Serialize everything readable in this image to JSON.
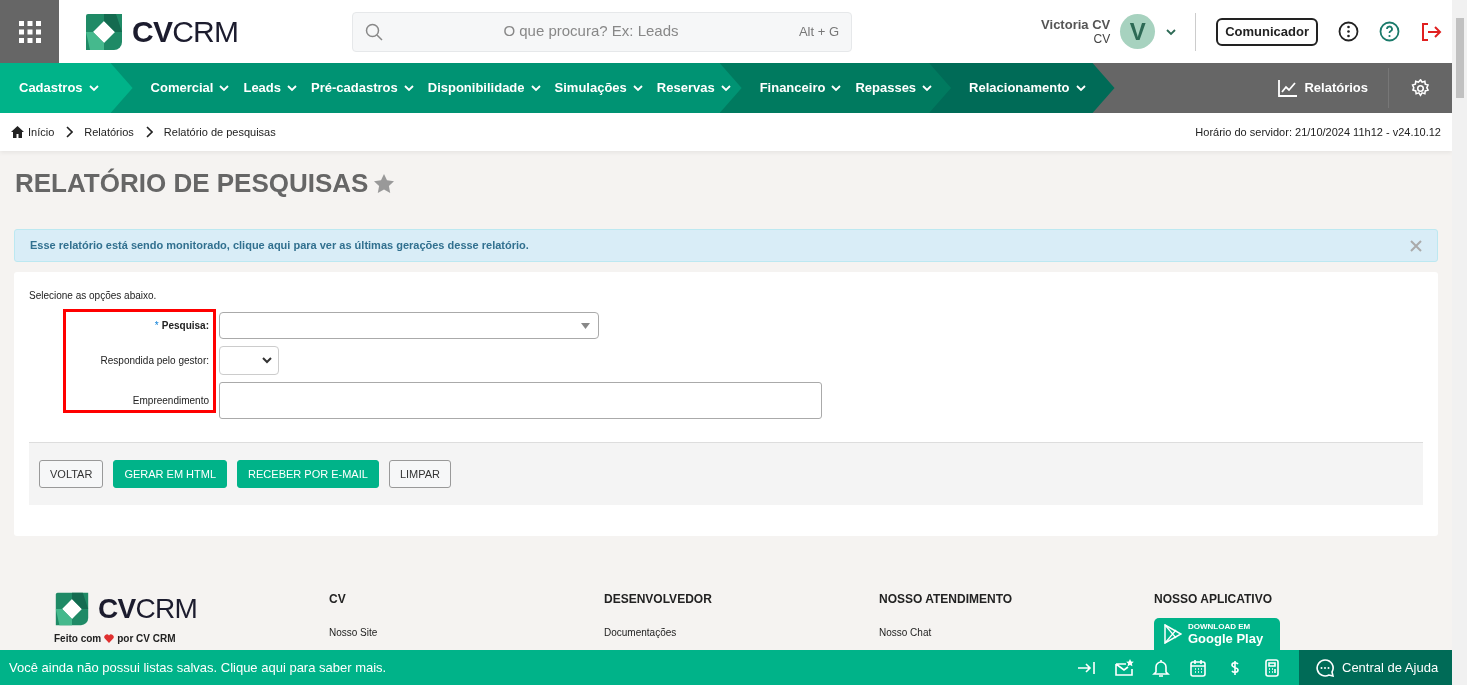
{
  "header": {
    "logo": "**CV**CRM",
    "search": {
      "placeholder": "O que procura? Ex: Leads",
      "shortcut": "Alt + G"
    },
    "user": {
      "name": "Victoria CV",
      "subtitle": "CV",
      "initial": "V"
    },
    "communicator_button": "Comunicador"
  },
  "nav": {
    "groups": [
      {
        "color": "#00b389",
        "items": [
          "Cadastros"
        ]
      },
      {
        "color": "#009373",
        "items": [
          "Comercial",
          "Leads",
          "Pré-cadastros",
          "Disponibilidade",
          "Simulações",
          "Reservas"
        ]
      },
      {
        "color": "#007a5f",
        "items": [
          "Financeiro",
          "Repasses"
        ]
      },
      {
        "color": "#006b57",
        "items": [
          "Relacionamento"
        ]
      }
    ],
    "reports_link": "Relatórios"
  },
  "breadcrumb": {
    "items": [
      "Início",
      "Relatórios",
      "Relatório de pesquisas"
    ],
    "server_time": "Horário do servidor: 21/10/2024 11h12 - v24.10.12"
  },
  "page_title": "RELATÓRIO DE PESQUISAS",
  "favorite": false,
  "alert": "Esse relatório está sendo monitorado, clique aqui para ver as últimas gerações desse relatório.",
  "form": {
    "intro": "Selecione as opções abaixo.",
    "required_mark": "*",
    "labels_highlighted": true,
    "fields": [
      {
        "label": "Pesquisa:",
        "required": true,
        "kind": "select"
      },
      {
        "label": "Respondida pelo gestor:",
        "required": false,
        "kind": "small-select"
      },
      {
        "label": "Empreendimento",
        "required": false,
        "kind": "text"
      }
    ],
    "buttons": [
      {
        "label": "VOLTAR",
        "kind": "default"
      },
      {
        "label": "GERAR EM HTML",
        "kind": "primary"
      },
      {
        "label": "RECEBER POR E-MAIL",
        "kind": "primary"
      },
      {
        "label": "LIMPAR",
        "kind": "default"
      }
    ]
  },
  "footer": {
    "logo": "**CV**CRM",
    "tagline_start": "Feito com",
    "tagline_end": "por CV CRM",
    "columns": [
      {
        "heading": "CV",
        "links": [
          "Nosso Site"
        ]
      },
      {
        "heading": "DESENVOLVEDOR",
        "links": [
          "Documentações"
        ]
      },
      {
        "heading": "NOSSO ATENDIMENTO",
        "links": [
          "Nosso Chat"
        ]
      },
      {
        "heading": "NOSSO APLICATIVO",
        "badge": {
          "small": "DOWNLOAD EM",
          "large": "Google Play"
        }
      }
    ]
  },
  "bottom_bar": {
    "message": "Você ainda não possui listas salvas. Clique aqui para saber mais.",
    "help": "Central de Ajuda"
  }
}
